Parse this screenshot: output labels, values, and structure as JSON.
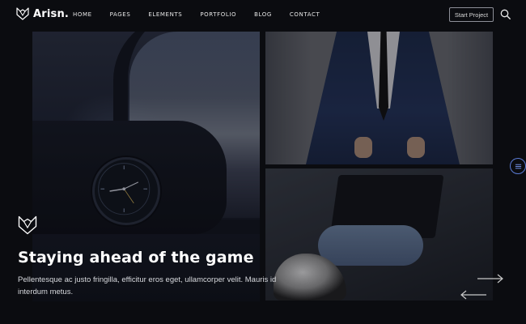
{
  "brand": {
    "name": "Arisn.",
    "logo_icon": "fox-head-icon"
  },
  "nav": {
    "items": [
      {
        "label": "HOME"
      },
      {
        "label": "PAGES"
      },
      {
        "label": "ELEMENTS"
      },
      {
        "label": "PORTFOLIO"
      },
      {
        "label": "BLOG"
      },
      {
        "label": "CONTACT"
      }
    ]
  },
  "header": {
    "cta_label": "Start Project",
    "search_icon": "search-icon"
  },
  "slide": {
    "title": "Staying ahead of the game",
    "description": "Pellentesque ac justo fringilla, efficitur eros eget, ullamcorper velit. Mauris id interdum metus.",
    "badge_icon": "fox-head-icon"
  },
  "controls": {
    "next_icon": "arrow-right-icon",
    "prev_icon": "arrow-left-icon",
    "side_menu_icon": "menu-icon"
  },
  "colors": {
    "background": "#0b0c10",
    "accent": "#5b7bd5",
    "text": "#ffffff",
    "muted_text": "#d7d9de"
  }
}
